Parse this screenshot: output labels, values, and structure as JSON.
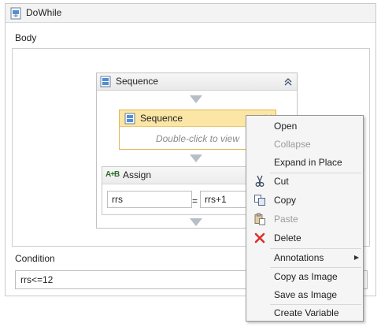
{
  "dowhile": {
    "title": "DoWhile",
    "body_label": "Body",
    "condition_label": "Condition",
    "condition_value": "rrs<=12"
  },
  "sequence": {
    "title": "Sequence"
  },
  "nested_sequence": {
    "title": "Sequence",
    "hint": "Double-click to view"
  },
  "assign": {
    "title": "Assign",
    "icon_text": "A+B",
    "to_value": "rrs",
    "equals": "=",
    "value": "rrs+1"
  },
  "context_menu": {
    "items": [
      {
        "label": "Open",
        "enabled": true,
        "icon": ""
      },
      {
        "label": "Collapse",
        "enabled": false,
        "icon": ""
      },
      {
        "label": "Expand in Place",
        "enabled": true,
        "icon": ""
      },
      {
        "label": "Cut",
        "enabled": true,
        "icon": "scissors-icon"
      },
      {
        "label": "Copy",
        "enabled": true,
        "icon": "copy-icon"
      },
      {
        "label": "Paste",
        "enabled": false,
        "icon": "paste-icon"
      },
      {
        "label": "Delete",
        "enabled": true,
        "icon": "delete-icon"
      },
      {
        "label": "Annotations",
        "enabled": true,
        "icon": "",
        "submenu": true
      },
      {
        "label": "Copy as Image",
        "enabled": true,
        "icon": ""
      },
      {
        "label": "Save as Image",
        "enabled": true,
        "icon": ""
      },
      {
        "label": "Create Variable",
        "enabled": true,
        "icon": ""
      }
    ]
  },
  "colors": {
    "selected_header": "#fbe6a6",
    "selected_border": "#e2b552",
    "delete_red": "#d9302a"
  }
}
